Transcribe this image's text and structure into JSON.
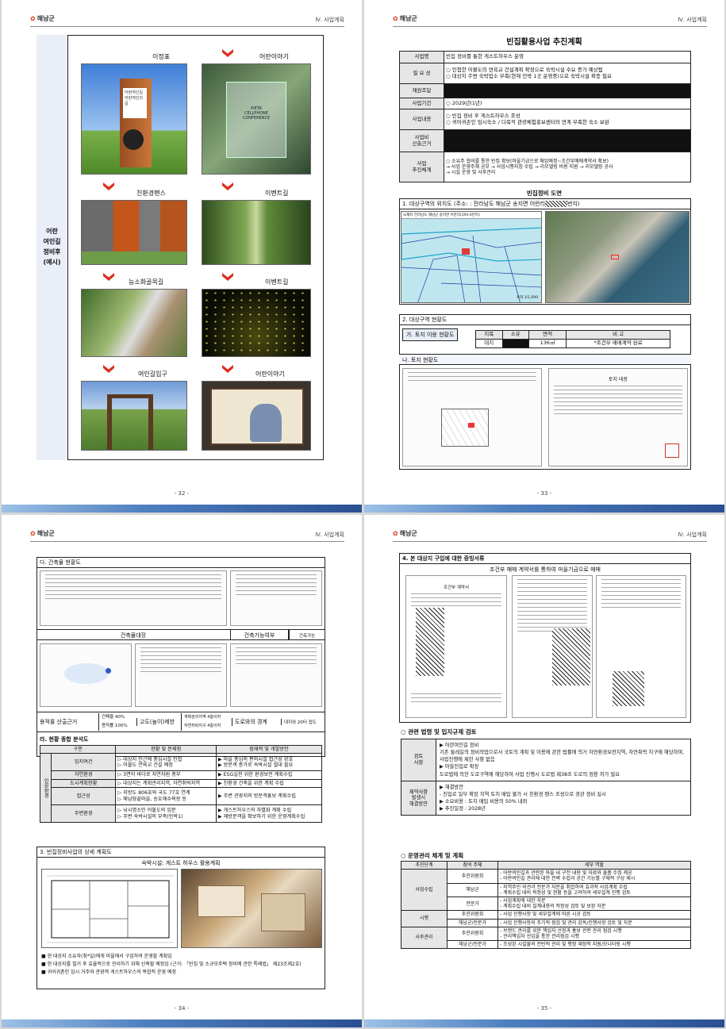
{
  "brand": "해남군",
  "section": "Ⅳ. 사업계획",
  "p32": {
    "page_no": "- 32 -",
    "side_label": "어란\n여인길\n정비후\n(예시)",
    "photos": [
      {
        "label": "이정표"
      },
      {
        "label": "어란이야기"
      },
      {
        "label": "친환경펜스"
      },
      {
        "label": "이벤트길"
      },
      {
        "label": "능소화골목길"
      },
      {
        "label": "이벤트길"
      },
      {
        "label": "여인길입구"
      },
      {
        "label": "어란이야기"
      }
    ],
    "sign_text": [
      "어란여인길",
      "어란여인의길"
    ],
    "memorial_text": "PIETA\nCELLPHONE\nCONFERENCE"
  },
  "p33": {
    "page_no": "- 33 -",
    "title": "빈집활용사업 추진계획",
    "rows": [
      {
        "k": "사업명",
        "v": "빈집 정비를 통한 게스트하우스 운영"
      },
      {
        "k": "필 요 성",
        "v": "○ 인접한 어불도의 연육교 건설계획 확정으로 숙박시설 수요 증가 예상됨\n○ 대상지 주변 숙박업소 부족(현재 민박 1곳 운영중)으로 숙박시설 확충 필요"
      },
      {
        "k": "재원조달",
        "v": ""
      },
      {
        "k": "사업기간",
        "v": "○ 2029년(1년)"
      },
      {
        "k": "사업내용",
        "v": "○ 빈집 정비 후 게스트하우스 조성\n○ 귀어귀촌인 임시숙소 / 다목적 관광체험홍보센터와 연계 부족한 숙소 보완"
      },
      {
        "k": "사업비\n산출근거",
        "v": ""
      },
      {
        "k": "사업\n추진체계",
        "v": "○ 소유주 협의를 통한 빈집 확보(마을기금으로 매입예정~조건부매매계약서 확보)\n  → 사업 운영주체 공모 → 사업시행지침 수립 → 리모델링 비용 지원 → 리모델링 공사\n  → 시설 운영 및 사후관리"
      }
    ],
    "drawing_title": "빈집정비 도면",
    "loc_heading": "1. 대상구역의 위치도  (주소: : 전라남도 해남군 송지면 어란리",
    "loc_heading_end": "번지)",
    "map_header": "소재지   전라남도 해남군 송지면 어란리(393-4번지)",
    "map_scale": "축척 1/1,000",
    "status_heading": "2. 대상구역 현황도",
    "land_use_label": "가. 토지 이용 현황도",
    "land_cols": [
      "지목",
      "소유",
      "면적",
      "비 고"
    ],
    "land_row": [
      "대지",
      "",
      "136㎡",
      "*조건부 매매계약 완료"
    ],
    "land_status_label": "나. 토지 현황도",
    "ledger_title": "토지 대장"
  },
  "p34": {
    "page_no": "- 34 -",
    "bldg_heading": "다. 건축물 현황도",
    "bldg_ledger": "건축물대장",
    "bldg_possible_label": "건축가능여부",
    "bldg_possible_val": "건축가능",
    "ratio_label": "용적률 산출근거",
    "ratio_cover": "건폐율 40%",
    "ratio_floor": "용적률 100%",
    "height_label": "고도(높이)제한",
    "height_val1": "계획관리지역 4층이하",
    "height_val2": "자연취락지구 4층이하",
    "road_label": "도로와의 경계",
    "road_val": "대지와 20터 접도",
    "analysis_heading": "라. 현황 종합 분석도",
    "an_cols": [
      "구분",
      "현황 및 문제점",
      "잠재력 및 개발방안"
    ],
    "an_group": "인문환경",
    "an_rows": [
      {
        "k": "입지여건",
        "p": "▷ 대상지 인근에 중심시설 인접\n▷ 어불도 연육교 건설 예정",
        "q": "▶ 마을 중심의 편의시설 접근성 양호\n▶ 방문객 증가로 숙박시설 절대 필요"
      },
      {
        "k": "자연환경",
        "p": "▷ 3면이 바다로 자연자원 풍부",
        "q": "▶ ESG실천 위한 환경보전 계획수립"
      },
      {
        "k": "도시계획현황",
        "p": "▷ 대상지는 계획관리지역, 자연취락지역",
        "q": "▶ 친환경 건축을 위한 계획 수립"
      },
      {
        "k": "접근성",
        "p": "▷ 지방도 806호와 국도 77호 연계\n▷ 해남땅끝마을, 송호해수욕장 등",
        "q": "▶ 주변 관광지의 방문객홍보 계획수립"
      },
      {
        "k": "주변환경",
        "p": "▷ 낚시명소인 어불도의 입문\n▷ 주변 숙박시설의 부족(민박1)",
        "q": "▶ 게스트하우스의 차별화 계획 수립\n▶ 재방문객을 확보하기 위한 운영계획수립"
      }
    ],
    "detail_heading": "3. 빈집정비사업의 상세 계획도",
    "detail_sub": "숙박시설: 게스트 하우스 활용계획",
    "bullets": [
      "■ 현 대상지 소유자(최*일)에게 마을에서 구입하여 운영할 계획임",
      "■ 현 대상지를 철거 후 효율적으로 관리하기 위해 신축할 예정임 (근거: 「빈집 및 소규모주택 정비에 관한 특례법」 제23조제2호)",
      "■ 귀어귀촌인 임시 거주와 관광객 게스트하우스의 복합적 운영 예정"
    ]
  },
  "p35": {
    "page_no": "- 35 -",
    "proof_heading": "4. 본 대상지 구입에 대한 증빙서류",
    "proof_sub": "조건부 매매 계약서를 통하여 마을기금으로 매매",
    "contract_title": "조건부 계약서",
    "law_heading": "○ 관련 법령 및 입지규제 검토",
    "law_rows": [
      {
        "k": "검토\n사항",
        "v": "▶ 어란여인길 정비\n기존 둘레길의 정비작업으로서 국토의 계획 및 이용에 관한 법률에 의거 자연환경보전지역, 자연취락 지구에 해당하며, 사업진행에 제한 사항 없음\n▶ 마을진입로 확장\n도로법에 의한 도로구역에 해당하여 사업 진행시 도로법 제38조 도로의 점용 허가 필요"
      },
      {
        "k": "제약사항\n발생시\n해결방안",
        "v": "▶ 해결방안\n - 진입로 일부 확장 지역 토지 매입 불가 시 친환경 펜스 조성으로 경관 정비 실시\n▶ 소요비용 : 토지 매입 비용의 50% 내외\n▶ 추진일정 : 2028년"
      }
    ],
    "ops_heading": "○ 운영관리 체계 및 계획",
    "ops_cols": [
      "추진단계",
      "참여 주체",
      "세부 역할"
    ],
    "ops": [
      {
        "stage": "사업수립",
        "items": [
          {
            "who": "추진위원회",
            "role": "- 어란여인길과 관련된 마을 내 구전 내용 및 자료와 물품 수집 제공\n- 어란여인길 관리에 대한 전략 수립과 공간 기능별 구체적 구상 제시"
          },
          {
            "who": "해남군",
            "role": "- 지역주민 의견과 전문가 자문을 취합하여 효과적 사업계획 수립\n- 계획수립 대비 적정성 및 현황 등을 고려하여 세부설계 진행 검토"
          },
          {
            "who": "전문가",
            "role": "- 사업계획에 대한 자문\n- 계획수립 대비 설계내용의 적정성 검토 및 보완 자문"
          }
        ]
      },
      {
        "stage": "시행",
        "items": [
          {
            "who": "추진위원회",
            "role": "- 사업 진행사항 및 세부설계에 따른 시공 검토"
          },
          {
            "who": "해남군/전문가",
            "role": "- 사업 진행사항의 주기적 점검 및 관리 감독/진행사항 검토 및 자문"
          }
        ]
      },
      {
        "stage": "사후관리",
        "items": [
          {
            "who": "추진위원회",
            "role": "- 브랜드 관리를 위한 책임자 선정과 홍보 관련 관리 점검 시행\n- 관리책임자 선임을 통한 관리점검 시행"
          },
          {
            "who": "해남군/전문가",
            "role": "- 조성된 시설물의 전반적 관리 및 행정 재정적 지원/모니터링 시행"
          }
        ]
      }
    ]
  },
  "colors": {
    "accent_red": "#d8321e",
    "header_blue": "#e8eef8",
    "footer_blue": "#2a4f93"
  }
}
